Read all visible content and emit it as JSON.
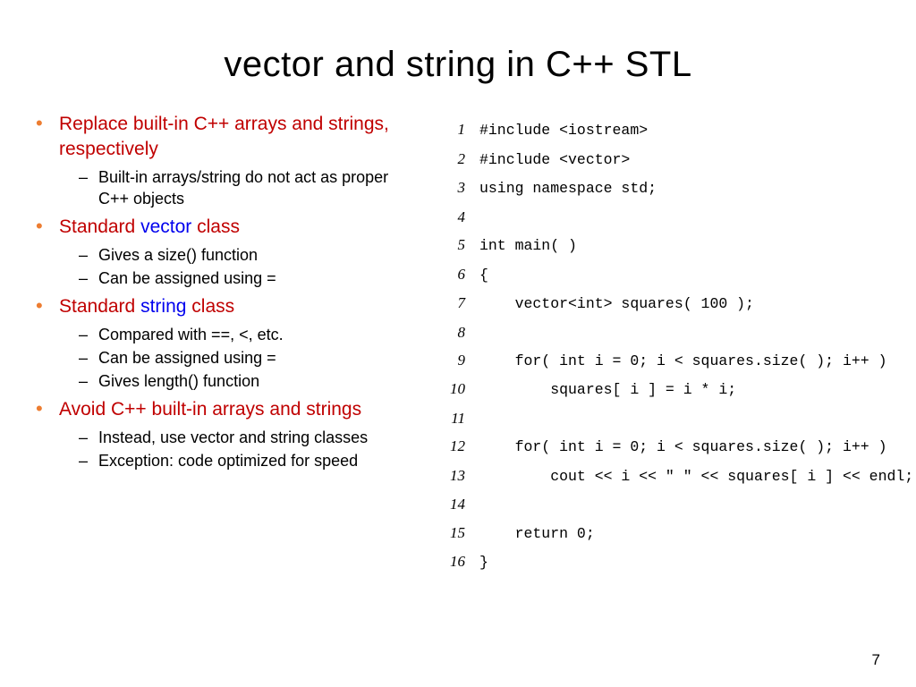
{
  "title": "vector and string in C++ STL",
  "page_number": "7",
  "bullets": [
    {
      "segments": [
        {
          "text": "Replace built-in C++ arrays and strings, respectively",
          "cls": ""
        }
      ],
      "sub": [
        "Built-in arrays/string do not act as proper C++ objects"
      ]
    },
    {
      "segments": [
        {
          "text": "Standard ",
          "cls": ""
        },
        {
          "text": "vector",
          "cls": "blue"
        },
        {
          "text": " class",
          "cls": ""
        }
      ],
      "sub": [
        "Gives a size() function",
        "Can be assigned using ="
      ]
    },
    {
      "segments": [
        {
          "text": "Standard ",
          "cls": ""
        },
        {
          "text": "string",
          "cls": "blue"
        },
        {
          "text": " class",
          "cls": ""
        }
      ],
      "sub": [
        "Compared with ==, <, etc.",
        "Can be assigned using =",
        "Gives length() function"
      ]
    },
    {
      "segments": [
        {
          "text": "Avoid C++ built-in arrays and strings",
          "cls": ""
        }
      ],
      "sub": [
        "Instead, use vector and string classes",
        "Exception: code optimized for speed"
      ]
    }
  ],
  "code": [
    {
      "n": "1",
      "t": "#include <iostream>"
    },
    {
      "n": "2",
      "t": "#include <vector>"
    },
    {
      "n": "3",
      "t": "using namespace std;"
    },
    {
      "n": "4",
      "t": ""
    },
    {
      "n": "5",
      "t": "int main( )"
    },
    {
      "n": "6",
      "t": "{"
    },
    {
      "n": "7",
      "t": "    vector<int> squares( 100 );"
    },
    {
      "n": "8",
      "t": ""
    },
    {
      "n": "9",
      "t": "    for( int i = 0; i < squares.size( ); i++ )"
    },
    {
      "n": "10",
      "t": "        squares[ i ] = i * i;"
    },
    {
      "n": "11",
      "t": ""
    },
    {
      "n": "12",
      "t": "    for( int i = 0; i < squares.size( ); i++ )"
    },
    {
      "n": "13",
      "t": "        cout << i << \" \" << squares[ i ] << endl;"
    },
    {
      "n": "14",
      "t": ""
    },
    {
      "n": "15",
      "t": "    return 0;"
    },
    {
      "n": "16",
      "t": "}"
    }
  ]
}
